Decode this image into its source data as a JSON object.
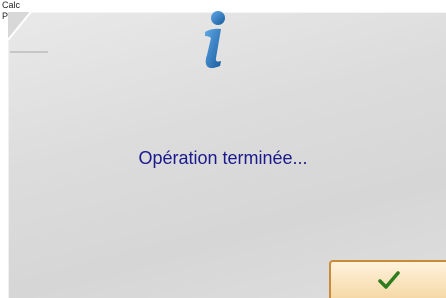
{
  "background_window": {
    "line1": "Calc",
    "line2": "P"
  },
  "dialog": {
    "message": "Opération terminée...",
    "icon": "info-icon",
    "ok_button_icon": "check-icon"
  },
  "colors": {
    "message_text": "#1a1a8c",
    "icon_blue": "#1f6fb2",
    "button_border": "#c98a3a",
    "check_green": "#2e7d1f"
  }
}
